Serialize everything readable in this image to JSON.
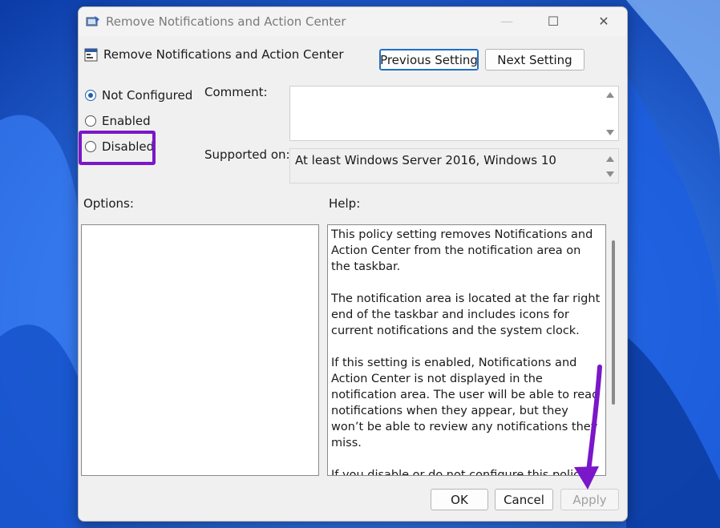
{
  "window": {
    "title": "Remove Notifications and Action Center",
    "controls": {
      "minimize": "—",
      "maximize": "☐",
      "close": "✕"
    }
  },
  "policy": {
    "name": "Remove Notifications and Action Center",
    "previous_label": "Previous Setting",
    "next_label": "Next Setting"
  },
  "state": {
    "options": [
      {
        "label": "Not Configured",
        "checked": true
      },
      {
        "label": "Enabled",
        "checked": false
      },
      {
        "label": "Disabled",
        "checked": false
      }
    ]
  },
  "comment": {
    "label": "Comment:",
    "value": ""
  },
  "supported": {
    "label": "Supported on:",
    "value": "At least Windows Server 2016, Windows 10"
  },
  "options_panel": {
    "label": "Options:"
  },
  "help": {
    "label": "Help:",
    "paragraphs": [
      "This policy setting removes Notifications and Action Center from the notification area on the taskbar.",
      "The notification area is located at the far right end of the taskbar and includes icons for current notifications and the system clock.",
      "If this setting is enabled, Notifications and Action Center is not displayed in the notification area. The user will be able to read notifications when they appear, but they won’t be able to review any notifications they miss.",
      "If you disable or do not configure this policy setting, Notification and Security and Maintenance will be displayed on the taskbar."
    ]
  },
  "footer": {
    "ok": "OK",
    "cancel": "Cancel",
    "apply": "Apply"
  },
  "annotations": {
    "highlight_color": "#7a17c9",
    "arrow_color": "#7a17c9"
  }
}
